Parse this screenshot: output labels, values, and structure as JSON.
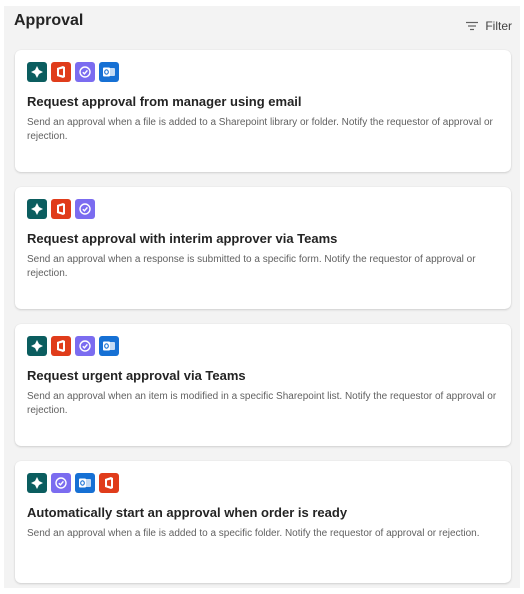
{
  "header": {
    "title": "Approval",
    "filter_label": "Filter"
  },
  "cards": [
    {
      "title": "Request approval from manager using email",
      "description": "Send an approval when a file is added to a Sharepoint library or folder. Notify the requestor of approval or rejection.",
      "icons": [
        "power-automate-icon",
        "office-icon",
        "approvals-icon",
        "outlook-icon"
      ]
    },
    {
      "title": "Request approval with interim approver via Teams",
      "description": "Send an approval when a response is submitted to a specific form. Notify the requestor of approval or rejection.",
      "icons": [
        "power-automate-icon",
        "office-icon",
        "approvals-icon"
      ]
    },
    {
      "title": "Request urgent approval via Teams",
      "description": "Send an approval when an item is modified in a specific Sharepoint list. Notify the requestor of approval or rejection.",
      "icons": [
        "power-automate-icon",
        "office-icon",
        "approvals-icon",
        "outlook-icon"
      ]
    },
    {
      "title": "Automatically start an approval when order is ready",
      "description": "Send an approval when a file is added to a specific folder. Notify the requestor of approval or rejection.",
      "icons": [
        "power-automate-icon",
        "approvals-icon",
        "outlook-icon",
        "office-icon"
      ]
    }
  ],
  "colors": {
    "power_automate": "#0b5d5f",
    "office": "#e03c1b",
    "approvals": "#7b6cf0",
    "outlook": "#1670d4"
  }
}
